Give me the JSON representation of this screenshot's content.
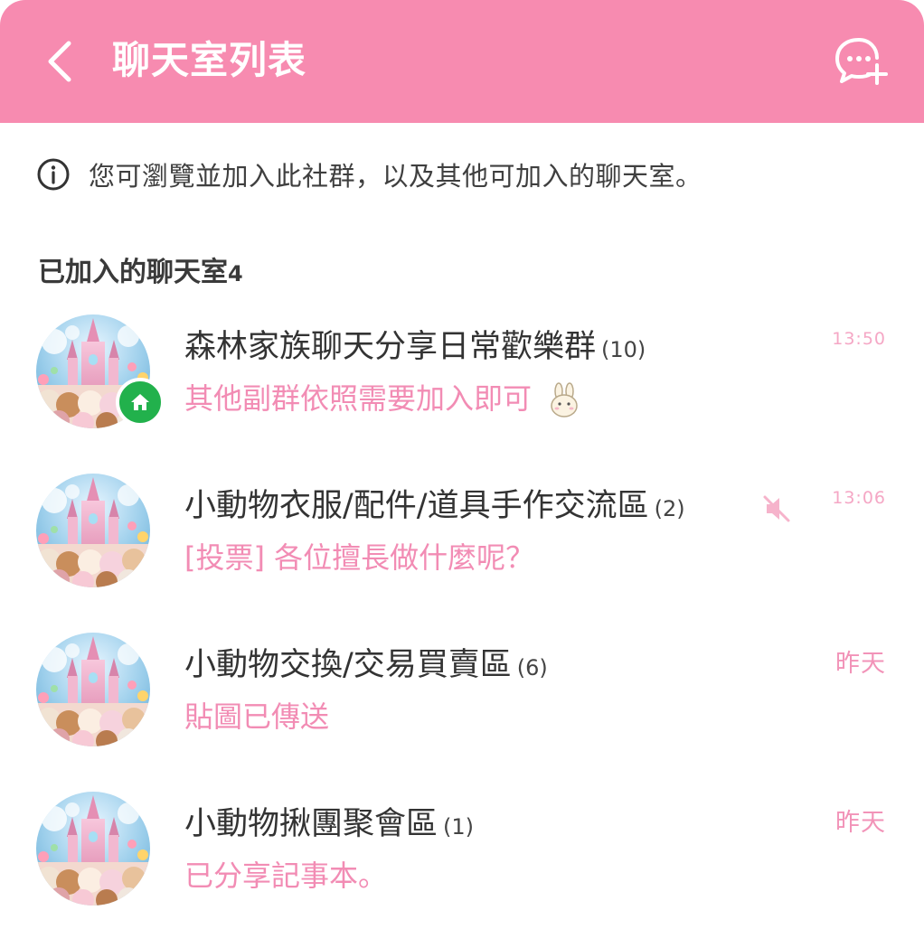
{
  "header": {
    "title": "聊天室列表",
    "background_color": "#f78bb0",
    "back_icon": "chevron-left-icon",
    "new_chat_icon": "chat-add-icon"
  },
  "info": {
    "icon": "info-icon",
    "text": "您可瀏覽並加入此社群，以及其他可加入的聊天室。"
  },
  "section": {
    "title": "已加入的聊天室",
    "count": "4"
  },
  "rooms": [
    {
      "name": "森林家族聊天分享日常歡樂群",
      "count": "(10)",
      "preview": "其他副群依照需要加入即可",
      "time": "13:50",
      "home_badge": true,
      "muted": false,
      "sticker": true
    },
    {
      "name": "小動物衣服/配件/道具手作交流區",
      "count": "(2)",
      "preview": "[投票] 各位擅長做什麼呢？",
      "time": "13:06",
      "home_badge": false,
      "muted": true,
      "sticker": false
    },
    {
      "name": "小動物交換/交易買賣區",
      "count": "(6)",
      "preview": "貼圖已傳送",
      "time": "昨天",
      "home_badge": false,
      "muted": false,
      "sticker": false
    },
    {
      "name": "小動物揪團聚會區",
      "count": "(1)",
      "preview": "已分享記事本。",
      "time": "昨天",
      "home_badge": false,
      "muted": false,
      "sticker": false
    }
  ],
  "colors": {
    "accent": "#f78bb0",
    "preview_text": "#f28cb4",
    "home_badge": "#22b14c"
  }
}
